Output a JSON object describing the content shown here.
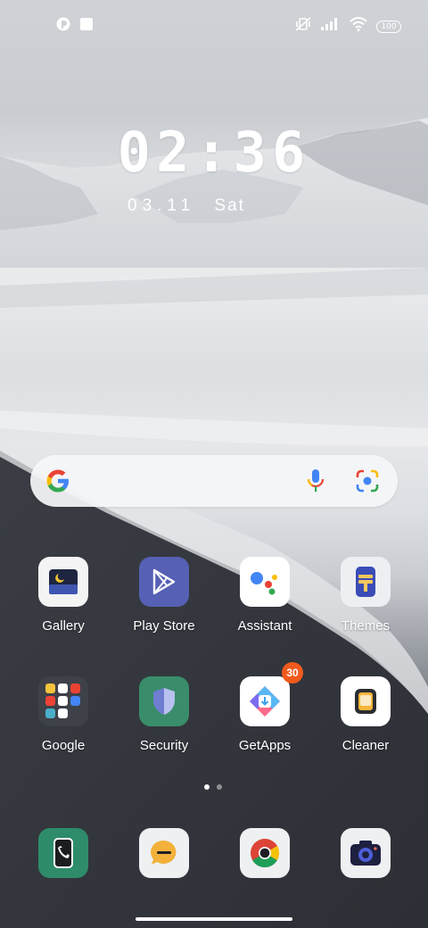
{
  "status_bar": {
    "battery": "100"
  },
  "clock": {
    "time": "02:36",
    "date": "03.11",
    "day": "Sat"
  },
  "search": {
    "placeholder": ""
  },
  "apps": {
    "gallery": "Gallery",
    "play_store": "Play Store",
    "assistant": "Assistant",
    "themes": "Themes",
    "google": "Google",
    "security": "Security",
    "getapps": "GetApps",
    "getapps_badge": "30",
    "cleaner": "Cleaner"
  },
  "page_indicator": {
    "pages": 2,
    "current": 1
  },
  "dock": [
    "phone",
    "messages",
    "chrome",
    "camera"
  ],
  "colors": {
    "badge": "#f05a1c",
    "security": "#3a8d6a",
    "play_store": "#5660b4",
    "phone": "#2e8c6b"
  }
}
